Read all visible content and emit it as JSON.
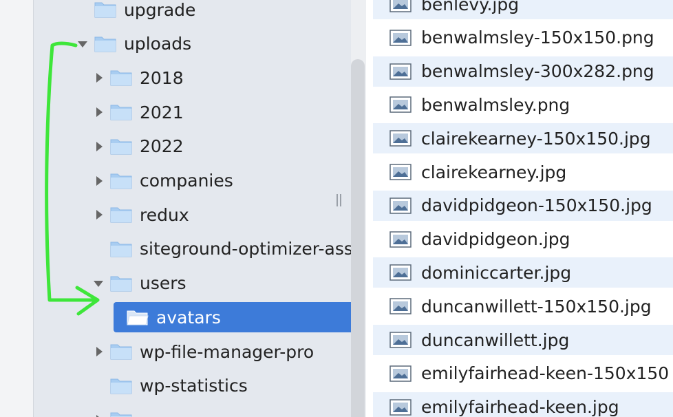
{
  "tree": {
    "rows": [
      {
        "label": "upgrade",
        "indent": 0,
        "state": "none",
        "open_folder": false
      },
      {
        "label": "uploads",
        "indent": 0,
        "state": "expanded",
        "open_folder": false
      },
      {
        "label": "2018",
        "indent": 1,
        "state": "collapsed",
        "open_folder": false
      },
      {
        "label": "2021",
        "indent": 1,
        "state": "collapsed",
        "open_folder": false
      },
      {
        "label": "2022",
        "indent": 1,
        "state": "collapsed",
        "open_folder": false
      },
      {
        "label": "companies",
        "indent": 1,
        "state": "collapsed",
        "open_folder": false
      },
      {
        "label": "redux",
        "indent": 1,
        "state": "collapsed",
        "open_folder": false
      },
      {
        "label": "siteground-optimizer-assets",
        "indent": 1,
        "state": "none",
        "open_folder": false
      },
      {
        "label": "users",
        "indent": 1,
        "state": "expanded",
        "open_folder": false
      },
      {
        "label": "avatars",
        "indent": 2,
        "state": "none",
        "open_folder": true,
        "selected": true
      },
      {
        "label": "wp-file-manager-pro",
        "indent": 1,
        "state": "collapsed",
        "open_folder": false
      },
      {
        "label": "wp-statistics",
        "indent": 1,
        "state": "none",
        "open_folder": false
      },
      {
        "label": "",
        "indent": 1,
        "state": "collapsed",
        "open_folder": false
      }
    ]
  },
  "files": [
    "benlevy.jpg",
    "benwalmsley-150x150.png",
    "benwalmsley-300x282.png",
    "benwalmsley.png",
    "clairekearney-150x150.jpg",
    "clairekearney.jpg",
    "davidpidgeon-150x150.jpg",
    "davidpidgeon.jpg",
    "dominiccarter.jpg",
    "duncanwillett-150x150.jpg",
    "duncanwillett.jpg",
    "emilyfairhead-keen-150x150",
    "emilyfairhead-keen.jpg"
  ],
  "icons": {
    "folder": "folder-icon",
    "open_folder": "folder-open-icon",
    "file": "image-file-icon",
    "annotation": "green-arrow-annotation"
  },
  "colors": {
    "selection": "#3d7bd9",
    "tree_bg": "#e4e8ee",
    "alt_row": "#e9f1fb",
    "annotation": "#3ee63a"
  }
}
